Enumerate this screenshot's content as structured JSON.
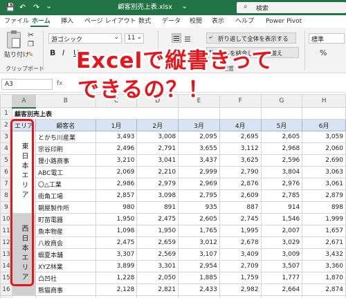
{
  "titlebar": {
    "autosave_icon": "💾",
    "undo_icon": "↶",
    "redo_icon": "↷",
    "customize_icon": "⌄",
    "doc_title": "顧客別売上表.xlsx",
    "title_dropdown_icon": "⌄",
    "search_icon": "⌕",
    "search_label": "検索"
  },
  "ribbon_tabs": [
    "ファイル",
    "ホーム",
    "挿入",
    "ページ レイアウト",
    "数式",
    "データ",
    "校閲",
    "表示",
    "ヘルプ",
    "Power Pivot"
  ],
  "ribbon": {
    "paste_label": "貼り付け",
    "clipboard_label": "クリップボード",
    "font_name": "游ゴシック",
    "font_size": "11",
    "bold": "B",
    "italic": "I",
    "underline": "U",
    "wrap_text": "折り返して全体を表示する",
    "merge_center": "セルを結合して中央揃え",
    "alignment_label": "配置",
    "number_format": "標準",
    "percent": "%"
  },
  "formula_bar": {
    "name_box": "A3",
    "fx": "fx"
  },
  "columns": [
    "A",
    "B",
    "C",
    "D",
    "E",
    "F",
    "G",
    "H"
  ],
  "row_numbers": [
    "1",
    "2",
    "3",
    "4",
    "5",
    "6",
    "7",
    "8",
    "9",
    "10",
    "11",
    "12",
    "13",
    "14",
    "15",
    "16",
    "17"
  ],
  "sheet": {
    "title": "顧客別売上表",
    "headers": [
      "エリア",
      "顧客名",
      "1月",
      "2月",
      "3月",
      "4月",
      "5月",
      "6月"
    ],
    "area_east": "東日本エリア",
    "area_west": "西日本エリア",
    "rows": [
      [
        "とかち川産業",
        "3,493",
        "3,008",
        "2,095",
        "2,695",
        "2,605",
        "3,059"
      ],
      [
        "宗谷印刷",
        "2,496",
        "2,791",
        "3,655",
        "3,112",
        "2,968",
        "2,060"
      ],
      [
        "狸小路商事",
        "3,210",
        "3,041",
        "3,437",
        "3,625",
        "2,596",
        "2,690"
      ],
      [
        "ABC電工",
        "2,069",
        "2,210",
        "2,999",
        "2,790",
        "3,804",
        "3,063"
      ],
      [
        "〇△工業",
        "2,986",
        "2,979",
        "2,969",
        "2,876",
        "2,976",
        "3,061"
      ],
      [
        "街角工場",
        "2,857",
        "3,098",
        "2,795",
        "2,609",
        "2,785",
        "2,879"
      ],
      [
        "朝屋製作所",
        "980",
        "891",
        "935",
        "887",
        "914",
        "898"
      ],
      [
        "町苗電器",
        "1,950",
        "2,475",
        "2,605",
        "2,745",
        "1,546",
        "1,999"
      ],
      [
        "魚本物産",
        "1,098",
        "1,950",
        "1,765",
        "1,995",
        "2,007",
        "1,657"
      ],
      [
        "八枚商会",
        "2,475",
        "2,659",
        "3,012",
        "2,678",
        "3,029",
        "2,671"
      ],
      [
        "蝦夏本舗",
        "3,307",
        "2,569",
        "3,107",
        "3,409",
        "3,009",
        "3,432"
      ],
      [
        "XYZ林業",
        "3,899",
        "3,301",
        "2,954",
        "2,709",
        "3,507",
        "3,360"
      ],
      [
        "凸凹社",
        "1,228",
        "2,050",
        "1,885",
        "1,759",
        "1,777",
        "1,870"
      ],
      [
        "熊猫商事",
        "2,128",
        "2,821",
        "2,433",
        "2,982",
        "2,664",
        "2,874"
      ]
    ]
  },
  "caption": {
    "line1": "Excelで縦書きって",
    "line2": "できるの？！"
  },
  "colors": {
    "excel_green": "#217346",
    "highlight_red": "#e8141c",
    "header_fill": "#d9e4f2",
    "west_fill": "#d0d0d0"
  }
}
